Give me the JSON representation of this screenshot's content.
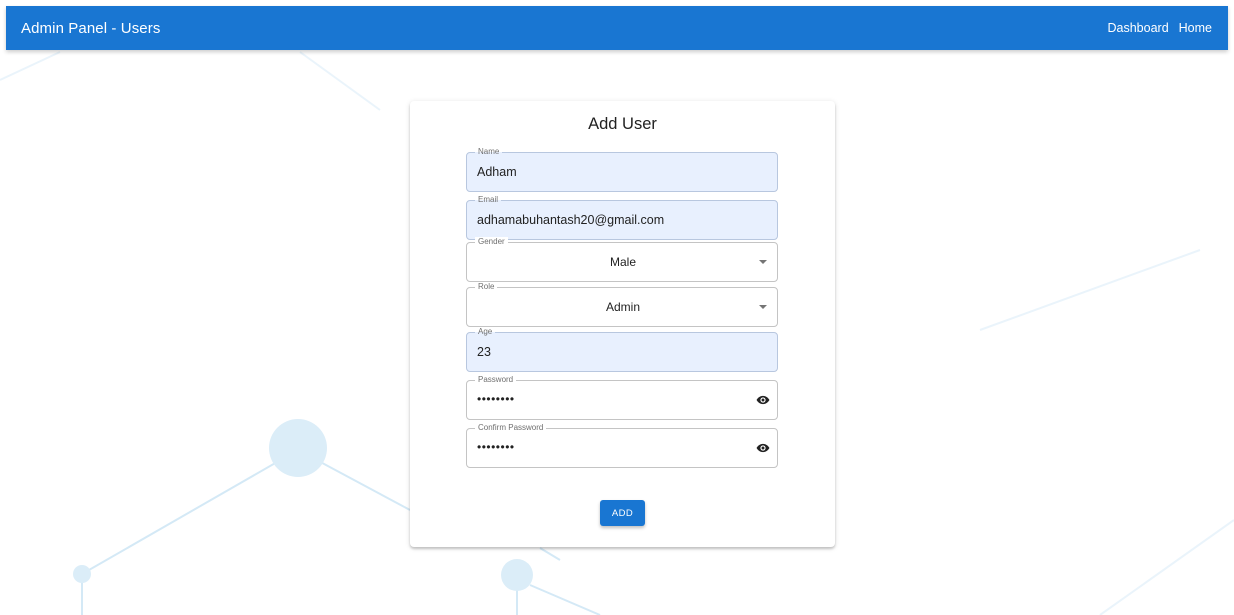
{
  "appbar": {
    "title": "Admin Panel - Users",
    "nav": [
      "Dashboard",
      "Home"
    ],
    "color": "#1976d2"
  },
  "form": {
    "title": "Add User",
    "fields": {
      "name": {
        "label": "Name",
        "value": "Adham"
      },
      "email": {
        "label": "Email",
        "value": "adhamabuhantash20@gmail.com"
      },
      "gender": {
        "label": "Gender",
        "value": "Male"
      },
      "role": {
        "label": "Role",
        "value": "Admin"
      },
      "age": {
        "label": "Age",
        "value": "23"
      },
      "password": {
        "label": "Password",
        "value": "••••••••"
      },
      "confirm_password": {
        "label": "Confirm Password",
        "value": "••••••••"
      }
    },
    "submit_label": "ADD"
  },
  "icons": {
    "select_caret": "chevron-down-icon",
    "password_toggle": "eye-icon"
  }
}
